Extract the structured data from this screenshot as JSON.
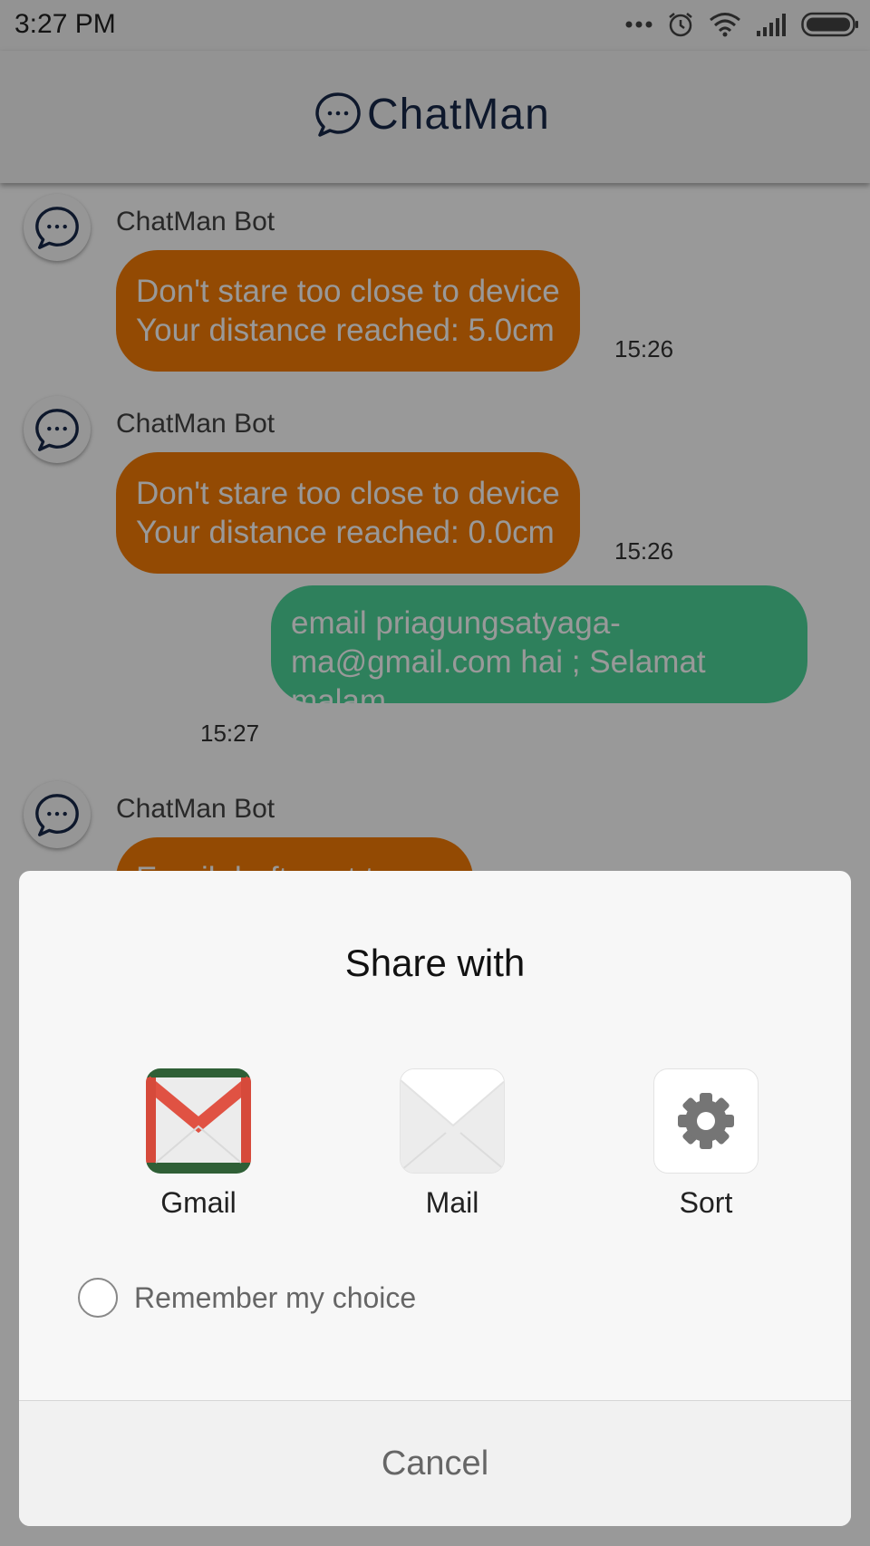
{
  "status_bar": {
    "time": "3:27 PM"
  },
  "header": {
    "app_title": "ChatMan"
  },
  "chat": {
    "messages": [
      {
        "sender": "ChatMan Bot",
        "text": "Don't stare too close to device\nYour distance reached: 5.0cm",
        "time": "15:26"
      },
      {
        "sender": "ChatMan Bot",
        "text": "Don't stare too close to device\nYour distance reached: 0.0cm",
        "time": "15:26"
      },
      {
        "sender": "",
        "text": "email priagungsatyaga-\nma@gmail.com hai ; Selamat\nmalam",
        "time": "15:27"
      },
      {
        "sender": "ChatMan Bot",
        "text": "Email draft sent to app",
        "time": ""
      }
    ]
  },
  "share_sheet": {
    "title": "Share  with",
    "options": [
      {
        "label": "Gmail",
        "icon": "gmail-icon"
      },
      {
        "label": "Mail",
        "icon": "mail-icon"
      },
      {
        "label": "Sort",
        "icon": "gear-icon"
      }
    ],
    "remember_label": "Remember my choice",
    "remember_checked": false,
    "cancel_label": "Cancel"
  },
  "colors": {
    "bot_bubble": "#f67c06",
    "user_bubble": "#4dd59a",
    "brand_text": "#18294a",
    "gmail_red": "#e05243",
    "gmail_green": "#2f5f36"
  }
}
